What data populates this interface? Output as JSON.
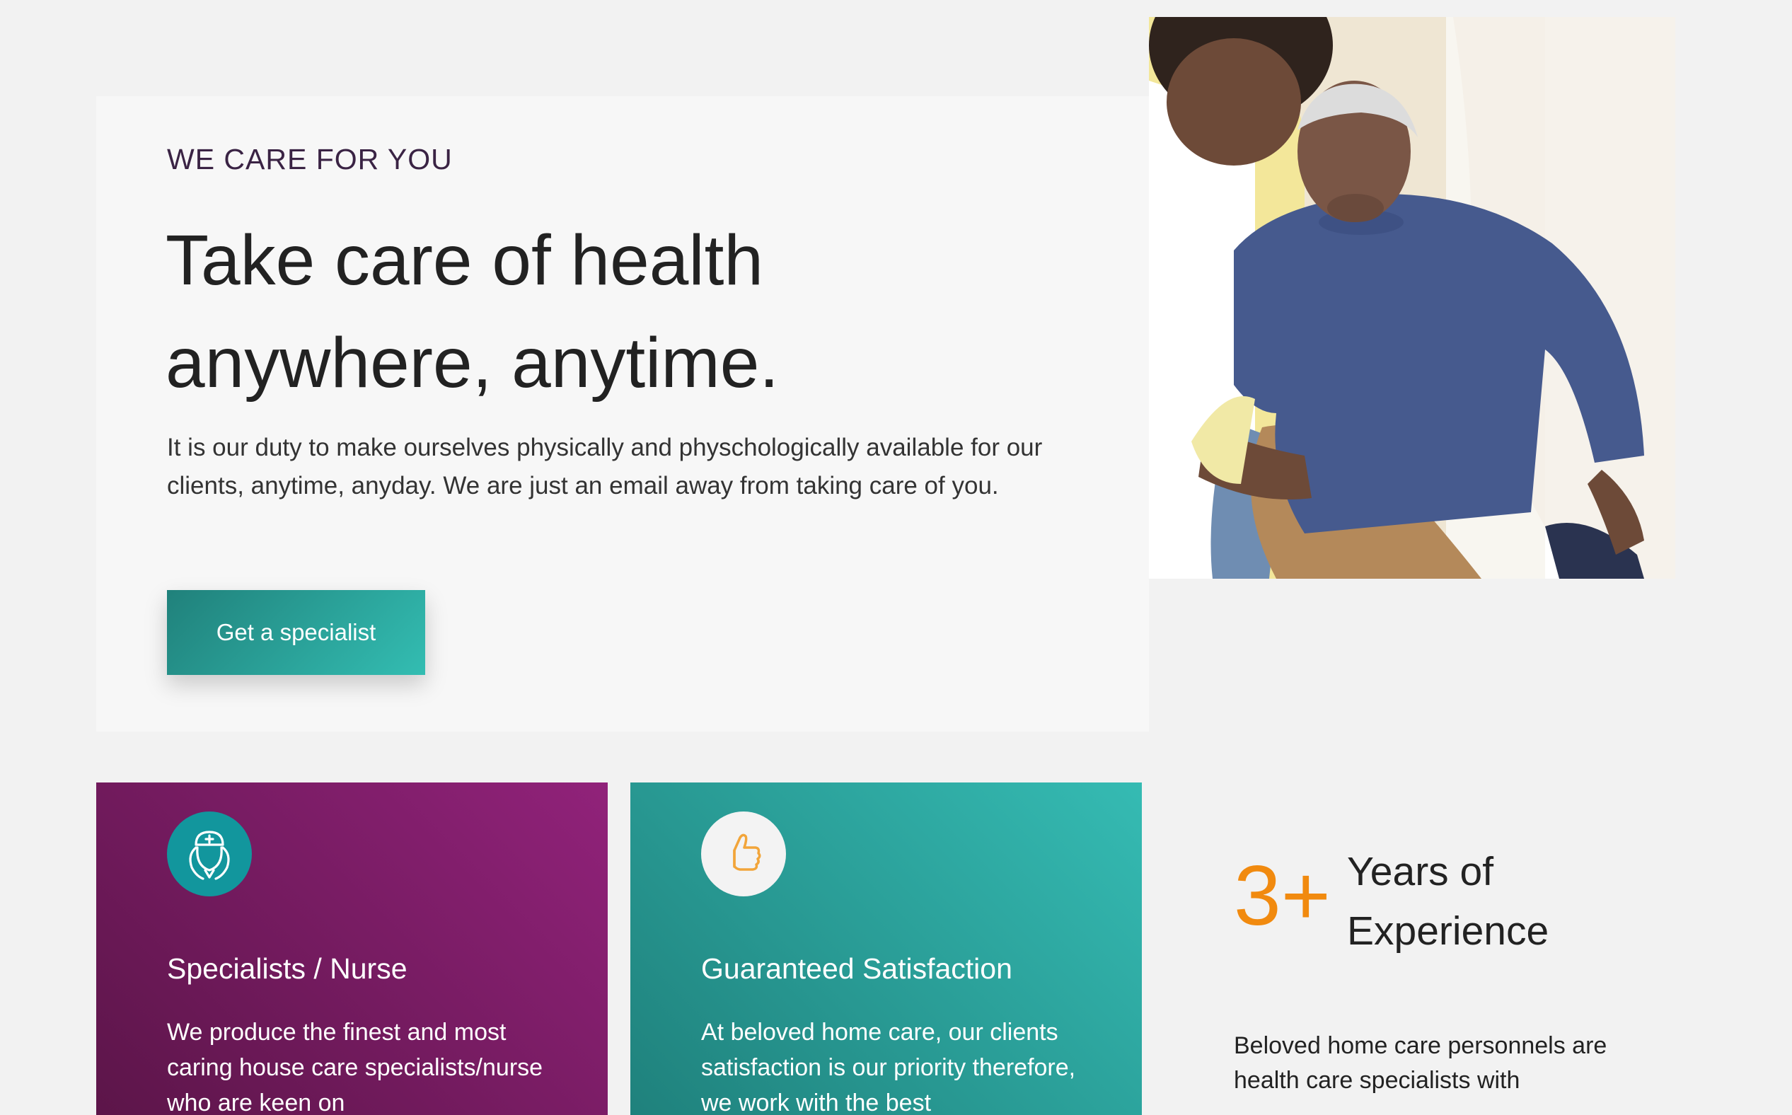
{
  "hero": {
    "eyebrow": "WE CARE FOR YOU",
    "headline": "Take care of health anywhere, anytime.",
    "intro": "It is our duty to make ourselves physically and physchologically available for our clients, anytime, anyday. We are just an email away from taking care of you.",
    "cta_label": "Get a specialist"
  },
  "features": [
    {
      "icon": "nurse-icon",
      "title": "Specialists / Nurse",
      "text": "We produce the finest and most caring house care specialists/nurse who are keen on"
    },
    {
      "icon": "thumbs-up-icon",
      "title": "Guaranteed Satisfaction",
      "text": "At beloved home care, our clients satisfaction is our priority therefore, we work with the best"
    }
  ],
  "experience": {
    "number": "3+",
    "label": "Years of Experience",
    "description": "Beloved home care personnels are health care specialists with"
  },
  "colors": {
    "accent_teal": "#2aa39b",
    "accent_purple": "#7a1d66",
    "accent_orange": "#f18a0f",
    "eyebrow": "#3a2344"
  }
}
